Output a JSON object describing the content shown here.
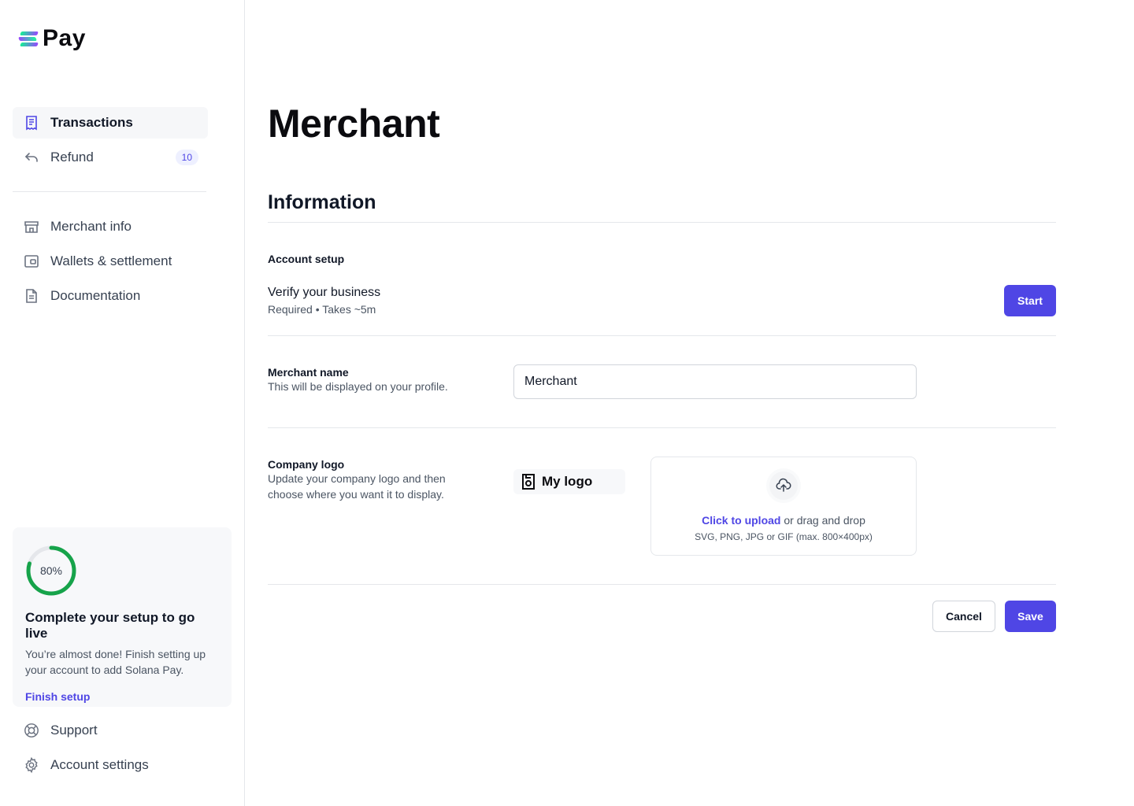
{
  "brand": {
    "name": "Pay"
  },
  "nav": {
    "primary": [
      {
        "label": "Transactions",
        "icon": "receipt-icon",
        "active": true
      },
      {
        "label": "Refund",
        "icon": "undo-arrow-icon",
        "badge": "10"
      }
    ],
    "secondary": [
      {
        "label": "Merchant info",
        "icon": "store-icon"
      },
      {
        "label": "Wallets & settlement",
        "icon": "wallet-icon"
      },
      {
        "label": "Documentation",
        "icon": "document-icon"
      }
    ],
    "bottom": [
      {
        "label": "Support",
        "icon": "lifebuoy-icon"
      },
      {
        "label": "Account settings",
        "icon": "gear-icon"
      }
    ]
  },
  "setup_card": {
    "progress_percent": 80,
    "progress_label": "80%",
    "title": "Complete your setup to go live",
    "description": "You’re almost done! Finish setting up your account to add Solana Pay.",
    "link": "Finish setup",
    "progress_color": "#16a34a"
  },
  "main": {
    "title": "Merchant",
    "section_title": "Information",
    "account_setup": {
      "label": "Account setup",
      "verify_title": "Verify your business",
      "verify_sub": "Required • Takes ~5m",
      "start_button": "Start"
    },
    "merchant_name": {
      "label": "Merchant name",
      "description": "This will be displayed on your profile.",
      "value": "Merchant"
    },
    "company_logo": {
      "label": "Company logo",
      "description": "Update your company logo and then choose where you want it to display.",
      "preview_text": "My logo",
      "upload_link": "Click to upload",
      "upload_rest": " or drag and drop",
      "upload_hint": "SVG, PNG, JPG or GIF (max. 800×400px)"
    },
    "actions": {
      "cancel": "Cancel",
      "save": "Save"
    }
  },
  "colors": {
    "accent": "#4f46e5",
    "progress": "#16a34a"
  }
}
